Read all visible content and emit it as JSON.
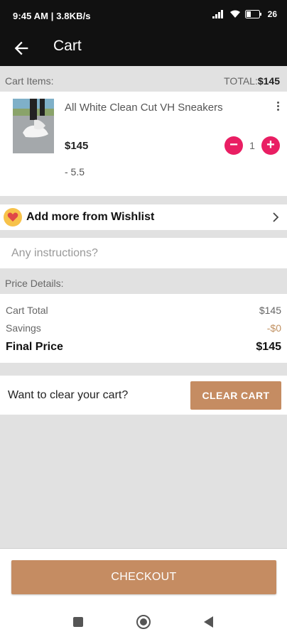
{
  "status_bar": {
    "time_speed": "9:45 AM | 3.8KB/s",
    "battery": "26"
  },
  "app_bar": {
    "title": "Cart",
    "back_icon": "arrow-left-icon"
  },
  "cart_header": {
    "label": "Cart Items:",
    "total_label": "TOTAL:",
    "total_value": "$145"
  },
  "cart_items": [
    {
      "name": "All White Clean Cut VH Sneakers",
      "price": "$145",
      "variant": "- 5.5",
      "quantity": "1",
      "image": "white-sneakers-photo"
    }
  ],
  "wishlist": {
    "label": "Add more from Wishlist",
    "icon": "heart-icon"
  },
  "instructions": {
    "placeholder": "Any instructions?"
  },
  "price_details": {
    "header": "Price Details:",
    "cart_total_label": "Cart Total",
    "cart_total_value": "$145",
    "savings_label": "Savings",
    "savings_value": "-$0",
    "final_price_label": "Final Price",
    "final_price_value": "$145"
  },
  "clear_cart": {
    "question": "Want to clear your cart?",
    "button_label": "CLEAR CART"
  },
  "checkout": {
    "button_label": "CHECKOUT"
  },
  "colors": {
    "accent_brown": "#c58c62",
    "stepper_pink": "#e91e63",
    "bar_black": "#111111",
    "background_gray": "#e1e1e1"
  }
}
